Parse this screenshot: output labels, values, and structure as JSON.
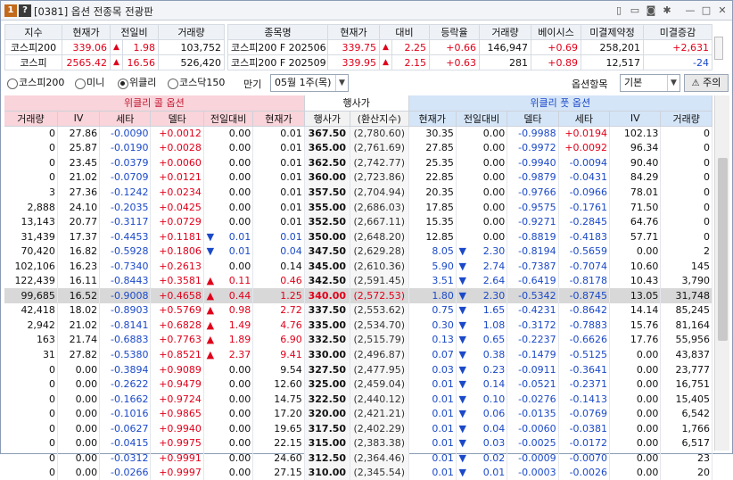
{
  "window": {
    "title": "[0381] 옵션 전종목 전광판",
    "badge1": "1",
    "badge2": "?",
    "controls": [
      "▯",
      "▭",
      "◙",
      "✱",
      "—",
      "□",
      "✕"
    ]
  },
  "summary_left": {
    "headers": [
      "지수",
      "현재가",
      "전일비",
      "거래량"
    ],
    "rows": [
      [
        "코스피200",
        "339.06",
        "▲",
        "1.98",
        "103,752",
        "up"
      ],
      [
        "코스피",
        "2565.42",
        "▲",
        "16.56",
        "526,420",
        "up"
      ]
    ]
  },
  "summary_right": {
    "headers": [
      "종목명",
      "현재가",
      "대비",
      "등락율",
      "거래량",
      "베이시스",
      "미결제약정",
      "미결증감"
    ],
    "rows": [
      [
        "코스피200 F 202506",
        "339.75",
        "▲",
        "2.25",
        "+0.66",
        "146,947",
        "+0.69",
        "258,201",
        "+2,631"
      ],
      [
        "코스피200 F 202509",
        "339.95",
        "▲",
        "2.15",
        "+0.63",
        "281",
        "+0.89",
        "12,517",
        "-24"
      ]
    ]
  },
  "controls": {
    "radios": [
      "코스피200",
      "미니",
      "위클리",
      "코스닥150"
    ],
    "selected": 2,
    "expiry_label": "만기",
    "expiry_value": "05월 1주(목)",
    "item_label": "옵션항목",
    "item_value": "기본",
    "warn": "주의"
  },
  "table": {
    "call_title": "위클리 콜 옵션",
    "mid_title": "행사가",
    "put_title": "위클리 풋 옵션",
    "call_cols": [
      "거래량",
      "IV",
      "세타",
      "델타",
      "전일대비",
      "현재가"
    ],
    "mid_cols": [
      "행사가",
      "(환산지수)"
    ],
    "put_cols": [
      "현재가",
      "전일대비",
      "델타",
      "세타",
      "IV",
      "거래량"
    ],
    "rows": [
      [
        "0",
        "27.86",
        "-0.0090",
        "+0.0012",
        "",
        "0.00",
        "0.01",
        "367.50",
        "(2,780.60)",
        "30.35",
        "",
        "0.00",
        "-0.9988",
        "+0.0194",
        "102.13",
        "0"
      ],
      [
        "0",
        "25.87",
        "-0.0190",
        "+0.0028",
        "",
        "0.00",
        "0.01",
        "365.00",
        "(2,761.69)",
        "27.85",
        "",
        "0.00",
        "-0.9972",
        "+0.0092",
        "96.34",
        "0"
      ],
      [
        "0",
        "23.45",
        "-0.0379",
        "+0.0060",
        "",
        "0.00",
        "0.01",
        "362.50",
        "(2,742.77)",
        "25.35",
        "",
        "0.00",
        "-0.9940",
        "-0.0094",
        "90.40",
        "0"
      ],
      [
        "0",
        "21.02",
        "-0.0709",
        "+0.0121",
        "",
        "0.00",
        "0.01",
        "360.00",
        "(2,723.86)",
        "22.85",
        "",
        "0.00",
        "-0.9879",
        "-0.0431",
        "84.29",
        "0"
      ],
      [
        "3",
        "27.36",
        "-0.1242",
        "+0.0234",
        "",
        "0.00",
        "0.01",
        "357.50",
        "(2,704.94)",
        "20.35",
        "",
        "0.00",
        "-0.9766",
        "-0.0966",
        "78.01",
        "0"
      ],
      [
        "2,888",
        "24.10",
        "-0.2035",
        "+0.0425",
        "",
        "0.00",
        "0.01",
        "355.00",
        "(2,686.03)",
        "17.85",
        "",
        "0.00",
        "-0.9575",
        "-0.1761",
        "71.50",
        "0"
      ],
      [
        "13,143",
        "20.77",
        "-0.3117",
        "+0.0729",
        "",
        "0.00",
        "0.01",
        "352.50",
        "(2,667.11)",
        "15.35",
        "",
        "0.00",
        "-0.9271",
        "-0.2845",
        "64.76",
        "0"
      ],
      [
        "31,439",
        "17.37",
        "-0.4453",
        "+0.1181",
        "▼",
        "0.01",
        "0.01",
        "350.00",
        "(2,648.20)",
        "12.85",
        "",
        "0.00",
        "-0.8819",
        "-0.4183",
        "57.71",
        "0"
      ],
      [
        "70,420",
        "16.82",
        "-0.5928",
        "+0.1806",
        "▼",
        "0.01",
        "0.04",
        "347.50",
        "(2,629.28)",
        "8.05",
        "▼",
        "2.30",
        "-0.8194",
        "-0.5659",
        "0.00",
        "2"
      ],
      [
        "102,106",
        "16.23",
        "-0.7340",
        "+0.2613",
        "",
        "0.00",
        "0.14",
        "345.00",
        "(2,610.36)",
        "5.90",
        "▼",
        "2.74",
        "-0.7387",
        "-0.7074",
        "10.60",
        "145"
      ],
      [
        "122,439",
        "16.11",
        "-0.8443",
        "+0.3581",
        "▲",
        "0.11",
        "0.46",
        "342.50",
        "(2,591.45)",
        "3.51",
        "▼",
        "2.64",
        "-0.6419",
        "-0.8178",
        "10.43",
        "3,790"
      ],
      [
        "99,685",
        "16.52",
        "-0.9008",
        "+0.4658",
        "▲",
        "0.44",
        "1.25",
        "340.00",
        "(2,572.53)",
        "1.80",
        "▼",
        "2.30",
        "-0.5342",
        "-0.8745",
        "13.05",
        "31,748"
      ],
      [
        "42,418",
        "18.02",
        "-0.8903",
        "+0.5769",
        "▲",
        "0.98",
        "2.72",
        "337.50",
        "(2,553.62)",
        "0.75",
        "▼",
        "1.65",
        "-0.4231",
        "-0.8642",
        "14.14",
        "85,245"
      ],
      [
        "2,942",
        "21.02",
        "-0.8141",
        "+0.6828",
        "▲",
        "1.49",
        "4.76",
        "335.00",
        "(2,534.70)",
        "0.30",
        "▼",
        "1.08",
        "-0.3172",
        "-0.7883",
        "15.76",
        "81,164"
      ],
      [
        "163",
        "21.74",
        "-0.6883",
        "+0.7763",
        "▲",
        "1.89",
        "6.90",
        "332.50",
        "(2,515.79)",
        "0.13",
        "▼",
        "0.65",
        "-0.2237",
        "-0.6626",
        "17.76",
        "55,956"
      ],
      [
        "31",
        "27.82",
        "-0.5380",
        "+0.8521",
        "▲",
        "2.37",
        "9.41",
        "330.00",
        "(2,496.87)",
        "0.07",
        "▼",
        "0.38",
        "-0.1479",
        "-0.5125",
        "0.00",
        "43,837"
      ],
      [
        "0",
        "0.00",
        "-0.3894",
        "+0.9089",
        "",
        "0.00",
        "9.54",
        "327.50",
        "(2,477.95)",
        "0.03",
        "▼",
        "0.23",
        "-0.0911",
        "-0.3641",
        "0.00",
        "23,777"
      ],
      [
        "0",
        "0.00",
        "-0.2622",
        "+0.9479",
        "",
        "0.00",
        "12.60",
        "325.00",
        "(2,459.04)",
        "0.01",
        "▼",
        "0.14",
        "-0.0521",
        "-0.2371",
        "0.00",
        "16,751"
      ],
      [
        "0",
        "0.00",
        "-0.1662",
        "+0.9724",
        "",
        "0.00",
        "14.75",
        "322.50",
        "(2,440.12)",
        "0.01",
        "▼",
        "0.10",
        "-0.0276",
        "-0.1413",
        "0.00",
        "15,405"
      ],
      [
        "0",
        "0.00",
        "-0.1016",
        "+0.9865",
        "",
        "0.00",
        "17.20",
        "320.00",
        "(2,421.21)",
        "0.01",
        "▼",
        "0.06",
        "-0.0135",
        "-0.0769",
        "0.00",
        "6,542"
      ],
      [
        "0",
        "0.00",
        "-0.0627",
        "+0.9940",
        "",
        "0.00",
        "19.65",
        "317.50",
        "(2,402.29)",
        "0.01",
        "▼",
        "0.04",
        "-0.0060",
        "-0.0381",
        "0.00",
        "1,766"
      ],
      [
        "0",
        "0.00",
        "-0.0415",
        "+0.9975",
        "",
        "0.00",
        "22.15",
        "315.00",
        "(2,383.38)",
        "0.01",
        "▼",
        "0.03",
        "-0.0025",
        "-0.0172",
        "0.00",
        "6,517"
      ],
      [
        "0",
        "0.00",
        "-0.0312",
        "+0.9991",
        "",
        "0.00",
        "24.60",
        "312.50",
        "(2,364.46)",
        "0.01",
        "▼",
        "0.02",
        "-0.0009",
        "-0.0070",
        "0.00",
        "23"
      ],
      [
        "0",
        "0.00",
        "-0.0266",
        "+0.9997",
        "",
        "0.00",
        "27.15",
        "310.00",
        "(2,345.54)",
        "0.01",
        "▼",
        "0.01",
        "-0.0003",
        "-0.0026",
        "0.00",
        "20"
      ]
    ],
    "selected_row": 11
  }
}
